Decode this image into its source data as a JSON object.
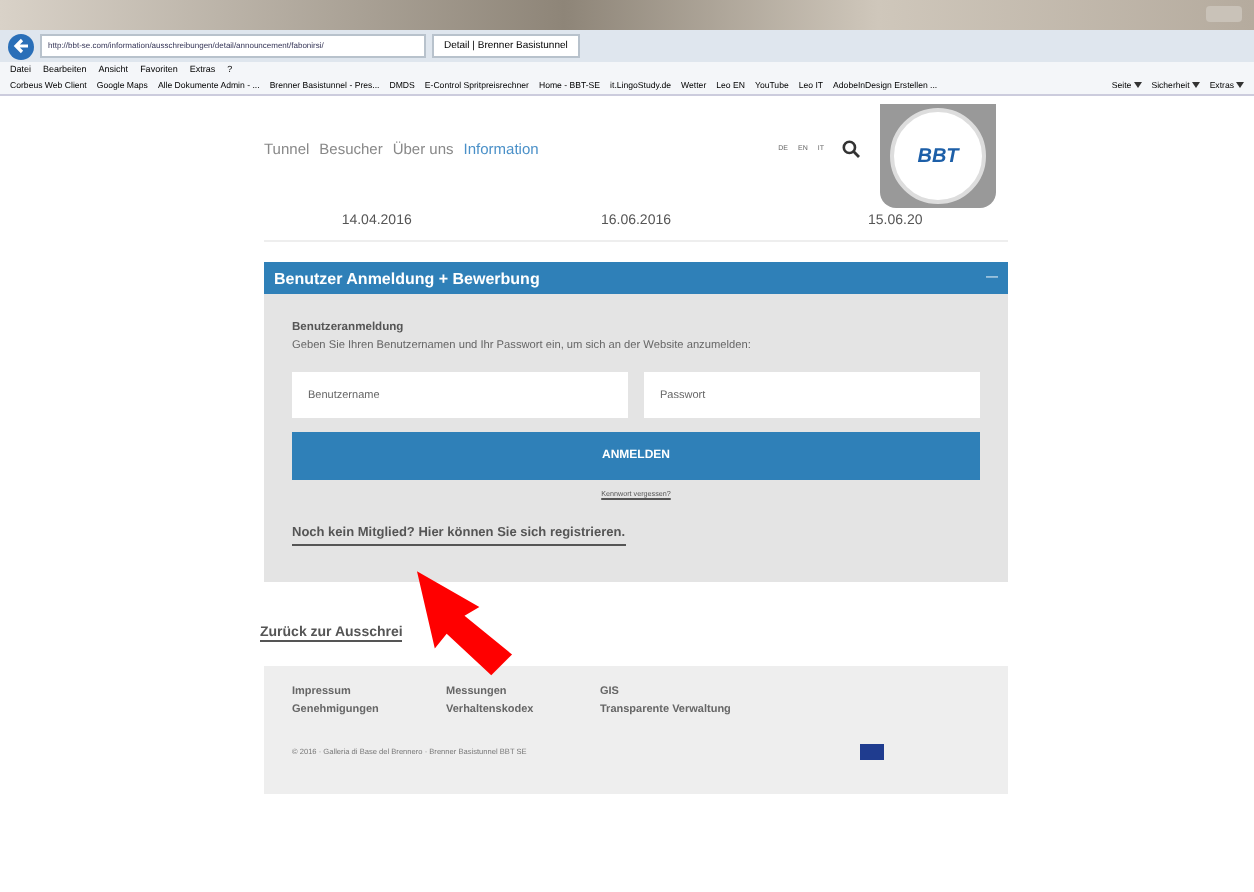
{
  "browser": {
    "url": "http://bbt-se.com/information/ausschreibungen/detail/announcement/fabonirsi/",
    "tab": "Detail | Brenner Basistunnel",
    "menu": [
      "Datei",
      "Bearbeiten",
      "Ansicht",
      "Favoriten",
      "Extras",
      "?"
    ],
    "favorites": [
      "Corbeus Web Client",
      "Google Maps",
      "Alle Dokumente Admin - ...",
      "Brenner Basistunnel - Pres...",
      "DMDS",
      "E-Control Spritpreisrechner",
      "Home - BBT-SE",
      "it.LingoStudy.de",
      "Wetter",
      "Leo EN",
      "YouTube",
      "Leo IT",
      "AdobeInDesign Erstellen ..."
    ],
    "tools": [
      "Seite",
      "Sicherheit",
      "Extras"
    ]
  },
  "nav": [
    {
      "label": "Tunnel",
      "selected": false
    },
    {
      "label": "Besucher",
      "selected": false
    },
    {
      "label": "Über uns",
      "selected": false
    },
    {
      "label": "Information",
      "selected": true
    }
  ],
  "languages": [
    "DE",
    "EN",
    "IT"
  ],
  "logo": "BBT",
  "dates": [
    "14.04.2016",
    "16.06.2016",
    "15.06.20"
  ],
  "login_panel": {
    "title": "Benutzer Anmeldung + Bewerbung",
    "toggle": "—",
    "heading": "Benutzeranmeldung",
    "intro": "Geben Sie Ihren Benutzernamen und Ihr Passwort ein, um sich an der Website anzumelden:",
    "username_placeholder": "Benutzername",
    "password_placeholder": "Passwort",
    "submit": "ANMELDEN",
    "forgot": "Kennwort vergessen?",
    "register": "Noch kein Mitglied? Hier können Sie sich registrieren."
  },
  "back_link": "Zurück zur Ausschrei",
  "footer": {
    "links": [
      [
        "Impressum",
        "Genehmigungen"
      ],
      [
        "Messungen",
        "Verhaltenskodex"
      ],
      [
        "GIS",
        "Transparente Verwaltung"
      ]
    ],
    "copyright": "© 2016 · Galleria di Base del Brennero · Brenner Basistunnel BBT SE"
  }
}
